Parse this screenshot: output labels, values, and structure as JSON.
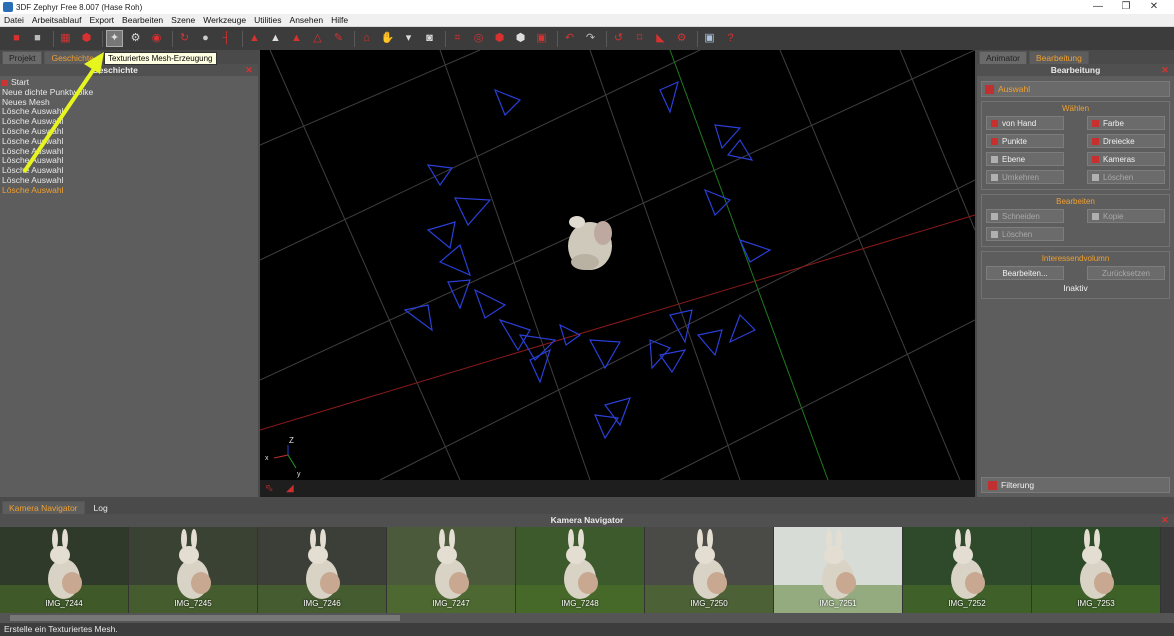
{
  "window": {
    "title": "3DF Zephyr Free 8.007 (Hase Roh)"
  },
  "menu": [
    "Datei",
    "Arbeitsablauf",
    "Export",
    "Bearbeiten",
    "Szene",
    "Werkzeuge",
    "Utilities",
    "Ansehen",
    "Hilfe"
  ],
  "toolbar": {
    "tooltip": "Texturiertes Mesh-Erzeugung",
    "icons": [
      "folder-open-icon",
      "save-icon",
      "project-wizard-icon",
      "dense-cloud-icon",
      "textured-mesh-icon",
      "camera-settings-icon",
      "screenshot-icon",
      "rotate-icon",
      "point-icon",
      "measure-icon",
      "pin-icon",
      "mesh-icon",
      "triangle-icon",
      "triangle-outline-icon",
      "brush-icon",
      "robot-icon",
      "hand-icon",
      "filter-icon",
      "boolean-icon",
      "grid-icon",
      "sphere-icon",
      "cube-icon",
      "hexagon-icon",
      "render-icon",
      "undo-icon",
      "redo-icon",
      "orbit-icon",
      "crop-icon",
      "ruler-icon",
      "settings-icon",
      "cube-view-icon",
      "help-icon"
    ],
    "active_index": 4
  },
  "left_panel": {
    "tabs": [
      "Projekt",
      "Geschichte"
    ],
    "active_tab": 1,
    "header": "Geschichte",
    "history": [
      "Start",
      "Neue dichte Punktwolke",
      "Neues Mesh",
      "Lösche Auswahl",
      "Lösche Auswahl",
      "Lösche Auswahl",
      "Lösche Auswahl",
      "Lösche Auswahl",
      "Lösche Auswahl",
      "Lösche Auswahl",
      "Lösche Auswahl",
      "Lösche Auswahl"
    ]
  },
  "viewport": {
    "axis_x": "x",
    "axis_y": "y",
    "axis_z": "Z"
  },
  "right_panel": {
    "tabs": [
      "Animator",
      "Bearbeitung"
    ],
    "active_tab": 1,
    "header": "Bearbeitung",
    "auswahl": "Auswahl",
    "waehlen": {
      "title": "Wählen",
      "buttons": [
        "von Hand",
        "Farbe",
        "Punkte",
        "Dreiecke",
        "Ebene",
        "Kameras",
        "Umkehren",
        "Löschen"
      ]
    },
    "bearbeiten": {
      "title": "Bearbeiten",
      "buttons": [
        "Schneiden",
        "Kopie",
        "Löschen"
      ]
    },
    "interessen": {
      "title": "Interessendvolumn",
      "buttons": [
        "Bearbeiten...",
        "Zurücksetzen"
      ],
      "status": "Inaktiv"
    },
    "filterung": "Filterung"
  },
  "bottom": {
    "tabs": [
      "Kamera Navigator",
      "Log"
    ],
    "active_tab": 0,
    "header": "Kamera Navigator",
    "thumbnails": [
      "IMG_7244",
      "IMG_7245",
      "IMG_7246",
      "IMG_7247",
      "IMG_7248",
      "IMG_7250",
      "IMG_7251",
      "IMG_7252",
      "IMG_7253"
    ]
  },
  "status": "Erstelle ein Texturiertes Mesh."
}
